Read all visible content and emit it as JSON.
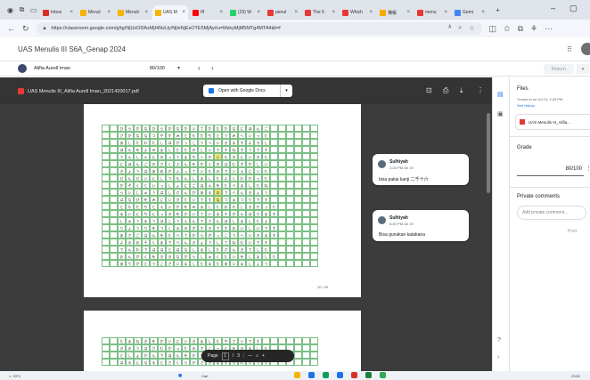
{
  "browser": {
    "tabs": [
      {
        "label": "Inbox",
        "color": "#d93025"
      },
      {
        "label": "Menul",
        "color": "#f4b400"
      },
      {
        "label": "Menuli",
        "color": "#f4b400"
      },
      {
        "label": "UAS M",
        "color": "#f4b400",
        "active": true
      },
      {
        "label": "Iff",
        "color": "#ff0000"
      },
      {
        "label": "(29) W",
        "color": "#25d366"
      },
      {
        "label": "penul",
        "color": "#e53935"
      },
      {
        "label": "The 5",
        "color": "#e53935"
      },
      {
        "label": "Which",
        "color": "#e53935"
      },
      {
        "label": "横帳",
        "color": "#f9ab00"
      },
      {
        "label": "menu",
        "color": "#e53935"
      },
      {
        "label": "Gemi",
        "color": "#4285f4"
      }
    ],
    "url": "https://classroom.google.com/g/tg/NjUxODAzMjI4NzUy/NjIxNjExOTE5MjAy#u=MzkyMjM5MTg4MTA4&t=f"
  },
  "classroom": {
    "class_title": "UAS Menulis III S6A_Genap 2024",
    "student_name": "Alifia Aurell Iman",
    "score": "80/100",
    "return_label": "Return"
  },
  "viewer": {
    "filename": "UAS Menulis III_Alifia Aurell Iman_2021420017.pdf",
    "open_with": "Open with Google Docs",
    "page_number_label": "10 / 20",
    "pager": {
      "label": "Page",
      "current": "1",
      "separator": "/",
      "total": "3"
    }
  },
  "grid_text": [
    "ひらがなひらがなかいてかたかなにほんご",
    "さかななつやすみともだちとうみへいった",
    "あしたわたしはがっこうへいきますよろし",
    "ほんをよみましたたのしいですねそうです",
    "でんしゃにのってまちへかいものにいきた",
    "にほんごのさくぶんをかくのはむずかしい",
    "きょうはあめがふっていたのでいえにいた",
    "せんせいにしつもんしましたよくわかった",
    "かぞくといっしょにごはんをたべましたね",
    "らいしゅうはしけんがあるのでべんきょう",
    "はなびをみにいきたいですなつまつりです",
    "ともだちとえいがをみましたおもしろかった",
    "まいにちにっきをかいていますがんばります",
    "しゅうまつはこうえんでさんぽしましたよ",
    "りょうりをつくるのがすきですおいしいです",
    "あさごはんをたべてからがっこうへいきます",
    "よるおそくまでべんきょうしてねむいです",
    "でんわでははとはなしましたげんきでした",
    "おんがくをききながらしゅくだいをしました",
    "ありがとうございましたまたあいましょう"
  ],
  "grid_text_page2": [
    "たまねぎをかいにいきましたやさいです",
    "きのうはさむかったのでこーとをきました",
    "としょかんでほんをかりましたむずかしい",
    "はるになるとさくらがさきますきれいです"
  ],
  "comments": [
    {
      "author": "Sulhiyah",
      "time": "2:26 PM Jul 19",
      "text": "bisa pakai kanji 二千十六"
    },
    {
      "author": "Sulhiyah",
      "time": "6:40 PM Jul 19",
      "text": "Bisa gunakan katakana"
    }
  ],
  "side": {
    "files_title": "Files",
    "turned_in": "Turned in on Jul 19, 2:25 PM",
    "see_history": "See history",
    "file_chip": "UAS Menulis III_Alifia...",
    "grade_title": "Grade",
    "grade_value": "80/100",
    "private_title": "Private comments",
    "private_placeholder": "Add private comment...",
    "post_label": "Post"
  },
  "taskbar": {
    "weather": "23°C",
    "search": "Cari",
    "time": "23:52"
  }
}
